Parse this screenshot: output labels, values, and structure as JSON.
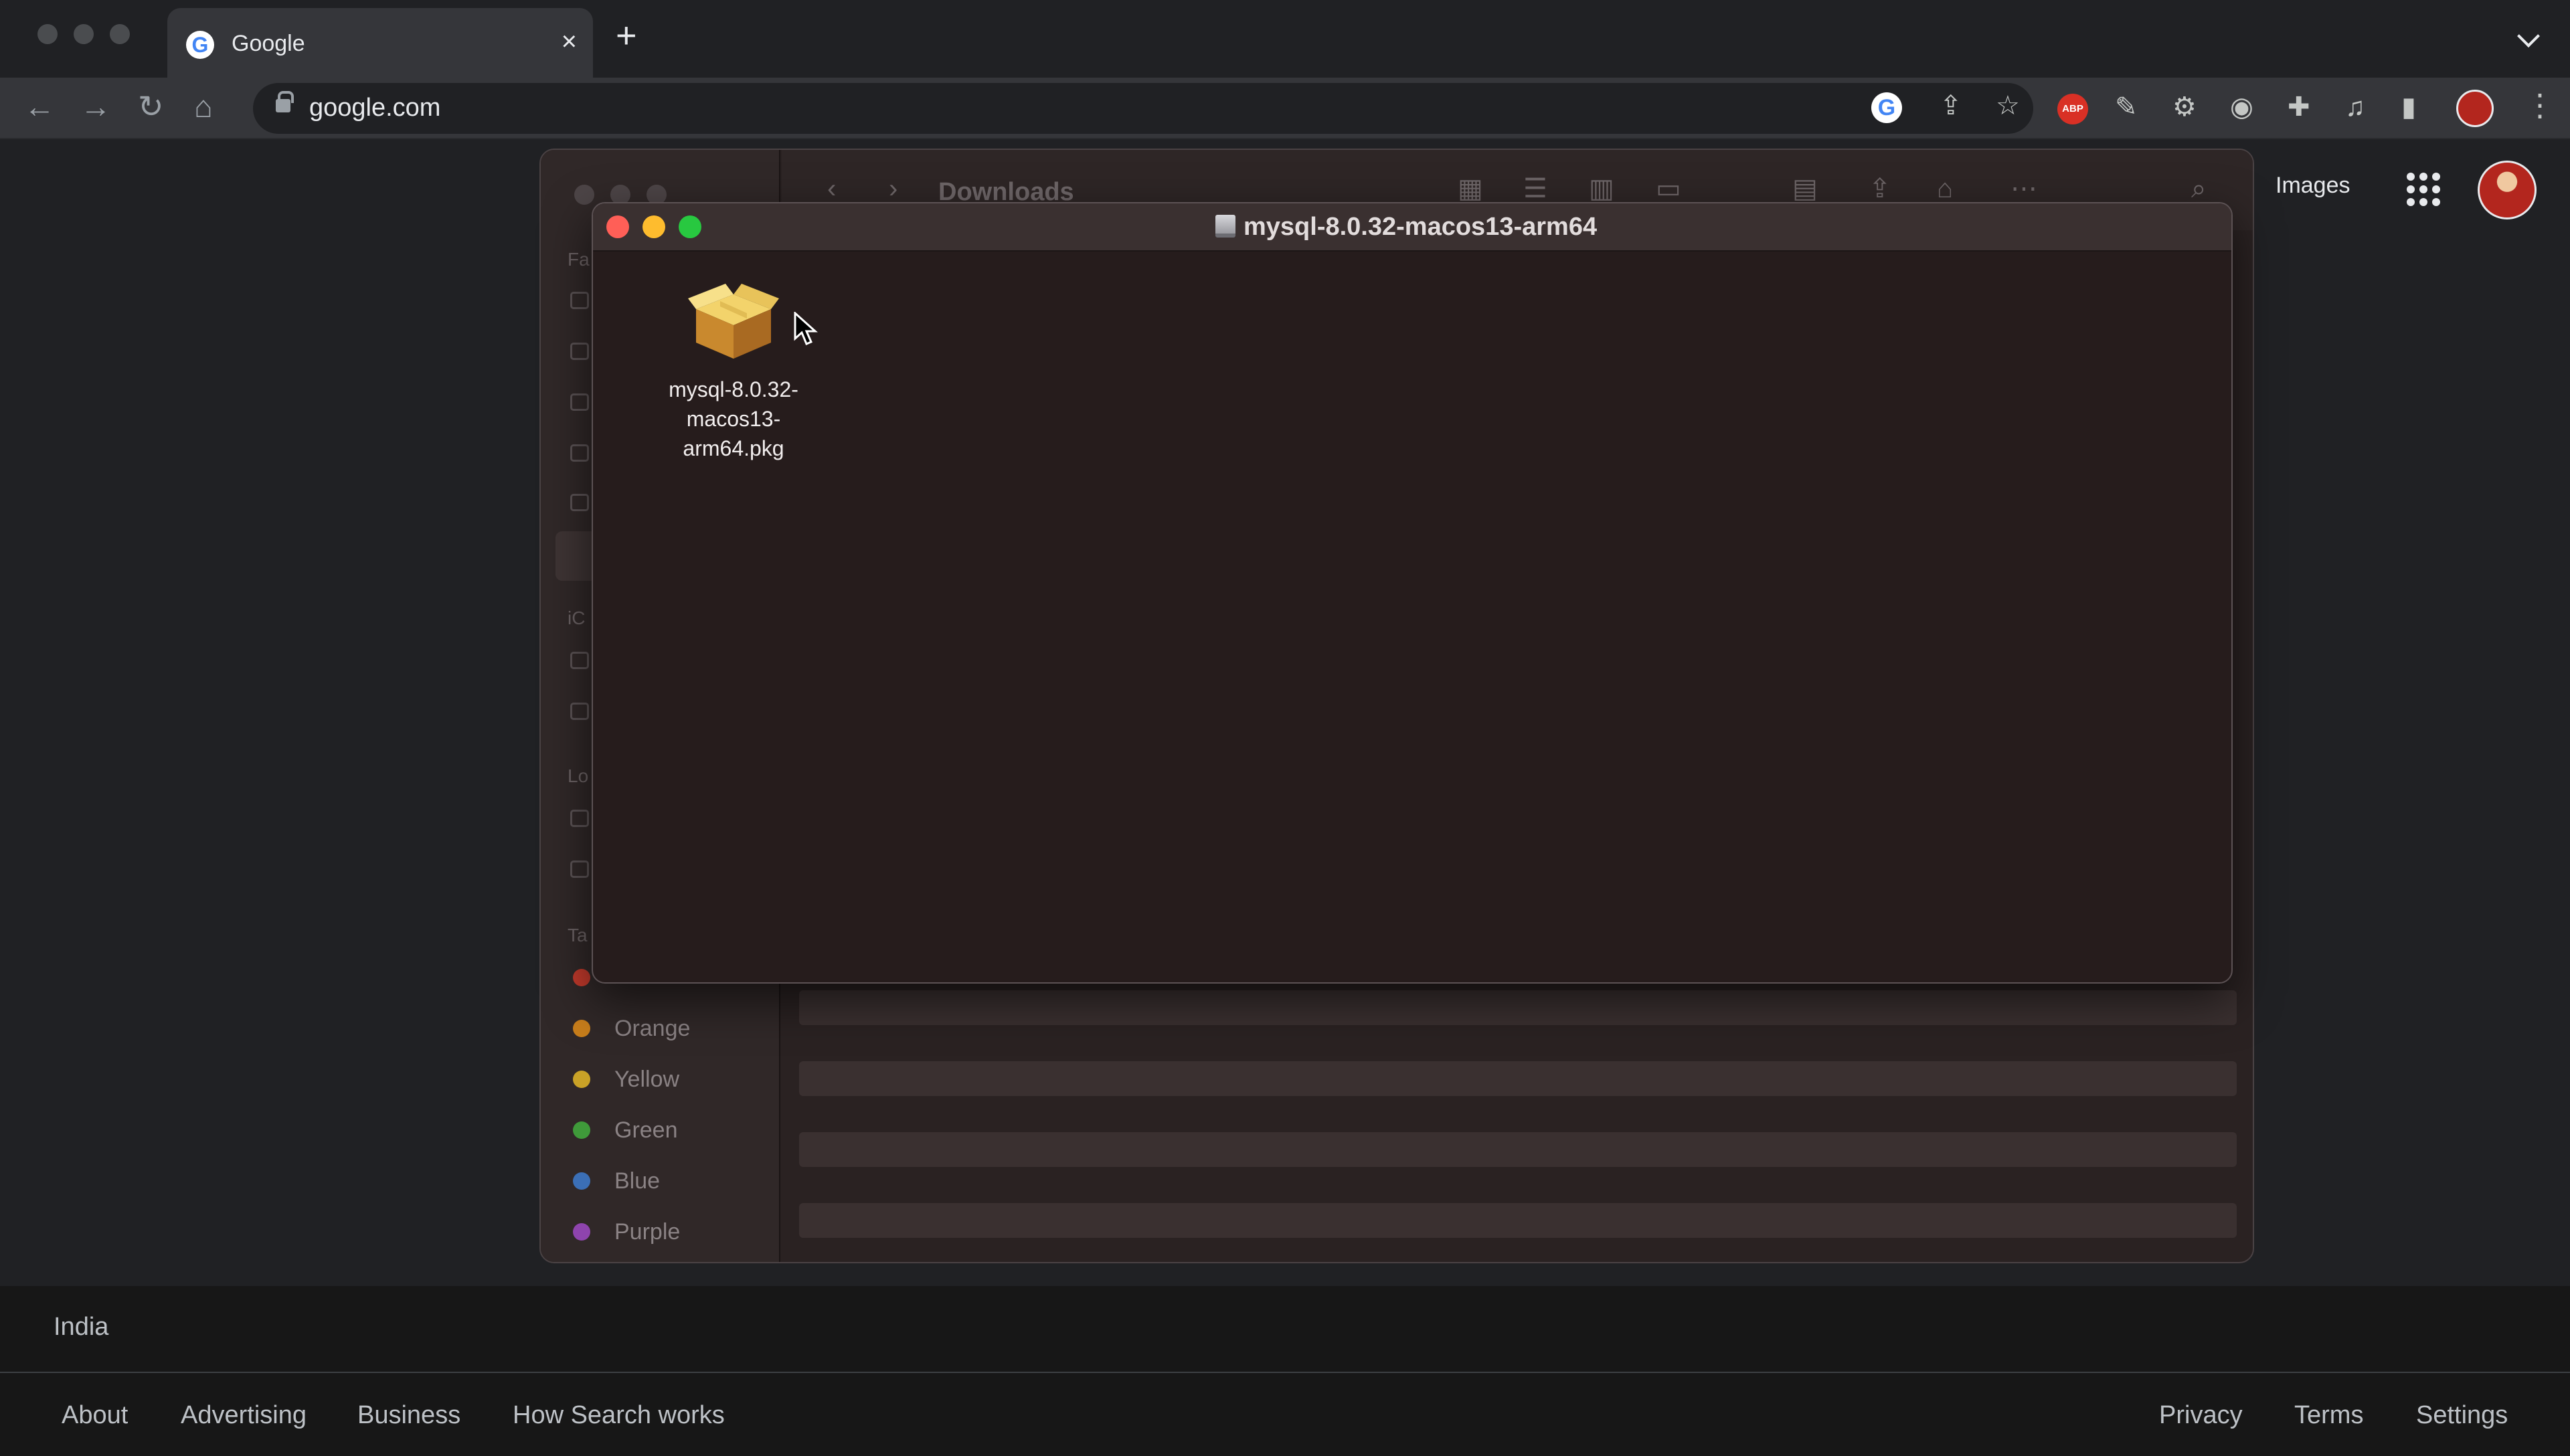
{
  "browser": {
    "tab": {
      "title": "Google",
      "favicon_letter": "G",
      "close_glyph": "×"
    },
    "new_tab_glyph": "+",
    "toolbar": {
      "back_icon": "←",
      "forward_icon": "→",
      "reload_icon": "↻",
      "home_icon": "⌂",
      "url": "google.com"
    },
    "extensions": {
      "abp_label": "ABP"
    }
  },
  "google": {
    "header": {
      "images_link": "Images"
    },
    "footer": {
      "country": "India",
      "left_links": [
        "About",
        "Advertising",
        "Business",
        "How Search works"
      ],
      "right_links": [
        "Privacy",
        "Terms",
        "Settings"
      ]
    }
  },
  "finder": {
    "title": "Downloads",
    "section_fragments": [
      "Fa",
      "iC",
      "Lo",
      "Ta"
    ],
    "tags": [
      {
        "label": "Orange",
        "color": "#c77d1b"
      },
      {
        "label": "Yellow",
        "color": "#c9a227"
      },
      {
        "label": "Green",
        "color": "#3f9a3a"
      },
      {
        "label": "Blue",
        "color": "#3b6fb6"
      },
      {
        "label": "Purple",
        "color": "#8e44ad"
      }
    ]
  },
  "dmg_window": {
    "title": "mysql-8.0.32-macos13-arm64",
    "items": [
      {
        "label": "mysql-8.0.32-macos13-\narm64.pkg",
        "icon": "package-icon"
      }
    ]
  },
  "colors": {
    "close": "#ff5f57",
    "minimize": "#febc2e",
    "zoom": "#28c840"
  }
}
